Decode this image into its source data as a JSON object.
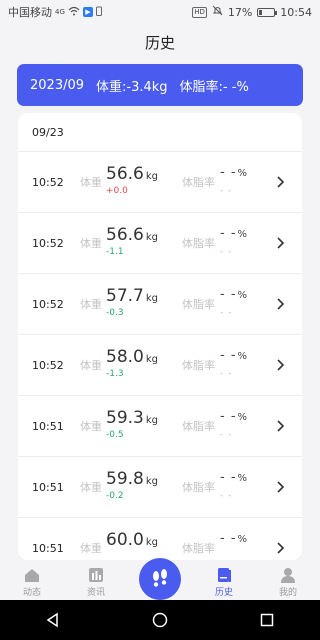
{
  "status_bar": {
    "carrier": "中国移动",
    "network": "4G",
    "battery": "17%",
    "time": "10:54",
    "hd": "HD"
  },
  "header": {
    "title": "历史"
  },
  "summary": {
    "month": "2023/09",
    "weight_text": "体重:-3.4kg",
    "bodyfat_text": "体脂率:- -%"
  },
  "list": {
    "date": "09/23",
    "weight_label": "体重",
    "fat_label": "体脂率",
    "rows": [
      {
        "time": "10:52",
        "weight": "56.6",
        "unit": "kg",
        "delta": "+0.0",
        "fat": "- -",
        "fat_unit": "%",
        "fat_delta": "- -"
      },
      {
        "time": "10:52",
        "weight": "56.6",
        "unit": "kg",
        "delta": "-1.1",
        "fat": "- -",
        "fat_unit": "%",
        "fat_delta": "- -"
      },
      {
        "time": "10:52",
        "weight": "57.7",
        "unit": "kg",
        "delta": "-0.3",
        "fat": "- -",
        "fat_unit": "%",
        "fat_delta": "- -"
      },
      {
        "time": "10:52",
        "weight": "58.0",
        "unit": "kg",
        "delta": "-1.3",
        "fat": "- -",
        "fat_unit": "%",
        "fat_delta": "- -"
      },
      {
        "time": "10:51",
        "weight": "59.3",
        "unit": "kg",
        "delta": "-0.5",
        "fat": "- -",
        "fat_unit": "%",
        "fat_delta": "- -"
      },
      {
        "time": "10:51",
        "weight": "59.8",
        "unit": "kg",
        "delta": "-0.2",
        "fat": "- -",
        "fat_unit": "%",
        "fat_delta": "- -"
      },
      {
        "time": "10:51",
        "weight": "60.0",
        "unit": "kg",
        "delta": "",
        "fat": "- -",
        "fat_unit": "%",
        "fat_delta": ""
      }
    ]
  },
  "bottom_nav": {
    "items": [
      {
        "label": "动态",
        "icon": "home-icon"
      },
      {
        "label": "资讯",
        "icon": "news-icon"
      },
      {
        "label": "",
        "icon": "footprint-icon"
      },
      {
        "label": "历史",
        "icon": "history-icon"
      },
      {
        "label": "我的",
        "icon": "profile-icon"
      }
    ]
  },
  "colors": {
    "accent": "#4a5cf0",
    "delta_up": "#e0474c",
    "delta_down": "#2aa86a"
  }
}
